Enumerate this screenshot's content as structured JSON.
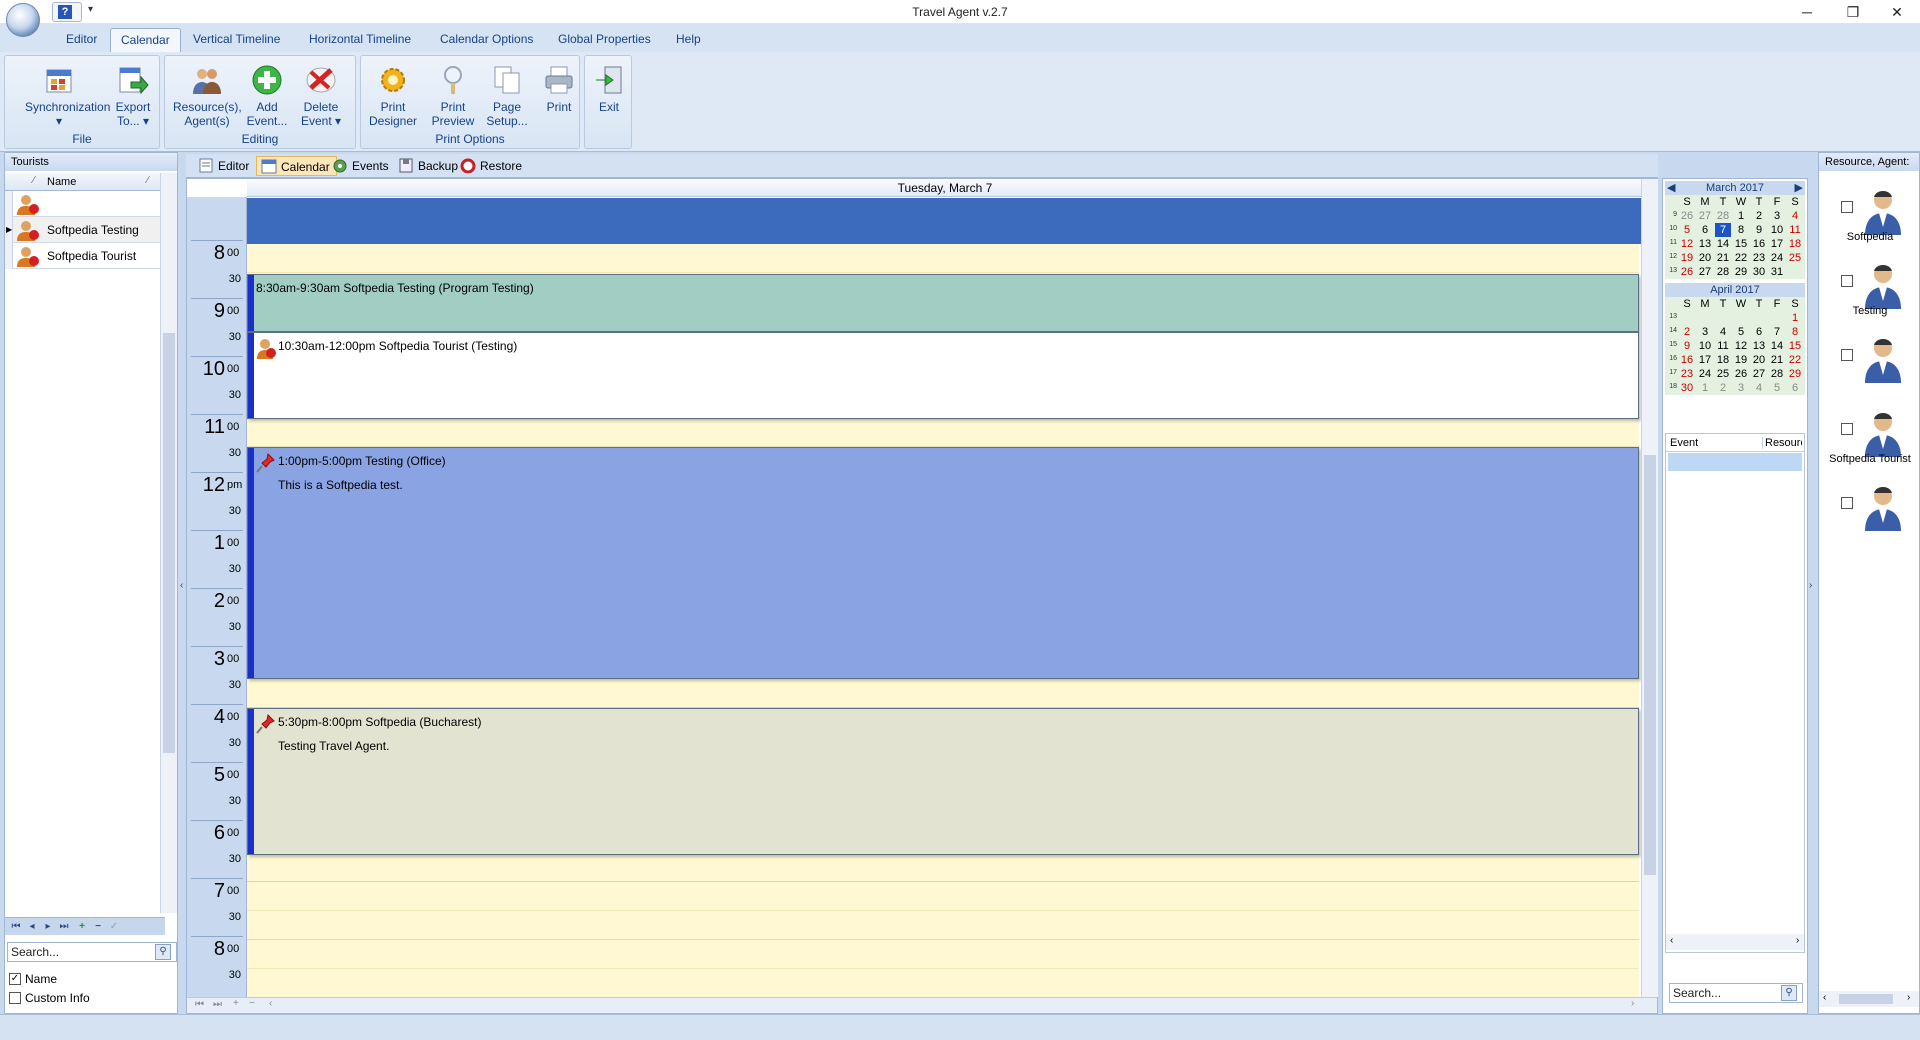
{
  "window": {
    "title": "Travel Agent v.2.7",
    "minimize": "─",
    "maximize": "❐",
    "close": "✕"
  },
  "qat": {
    "help": "?",
    "dropdown": "▾"
  },
  "menu_tabs": [
    {
      "label": "Editor"
    },
    {
      "label": "Calendar",
      "active": true
    },
    {
      "label": "Vertical Timeline"
    },
    {
      "label": "Horizontal Timeline"
    },
    {
      "label": "Calendar Options"
    },
    {
      "label": "Global Properties"
    },
    {
      "label": "Help"
    }
  ],
  "ribbon": {
    "groups": [
      {
        "label": "File",
        "buttons": [
          {
            "line1": "Synchronization",
            "line2": "▾"
          },
          {
            "line1": "Export",
            "line2": "To... ▾"
          }
        ]
      },
      {
        "label": "Editing",
        "buttons": [
          {
            "line1": "Resource(s),",
            "line2": "Agent(s)"
          },
          {
            "line1": "Add",
            "line2": "Event..."
          },
          {
            "line1": "Delete",
            "line2": "Event ▾"
          }
        ]
      },
      {
        "label": "Print Options",
        "buttons": [
          {
            "line1": "Print",
            "line2": "Designer"
          },
          {
            "line1": "Print",
            "line2": "Preview"
          },
          {
            "line1": "Page",
            "line2": "Setup..."
          },
          {
            "line1": "Print",
            "line2": ""
          }
        ]
      },
      {
        "label": "",
        "buttons": [
          {
            "line1": "Exit",
            "line2": ""
          }
        ]
      }
    ]
  },
  "tourists": {
    "title": "Tourists",
    "col_name": "Name",
    "rows": [
      {
        "name": ""
      },
      {
        "name": "Softpedia Testing"
      },
      {
        "name": "Softpedia Tourist"
      }
    ],
    "search_placeholder": "Search...",
    "opt_name": "Name",
    "opt_custom": "Custom Info"
  },
  "sub_tabs": [
    {
      "label": "Editor"
    },
    {
      "label": "Calendar",
      "active": true
    },
    {
      "label": "Events"
    },
    {
      "label": "Backup"
    },
    {
      "label": "Restore"
    }
  ],
  "calendar": {
    "date_header": "Tuesday, March 7",
    "hours": [
      {
        "n": "8",
        "s": "00"
      },
      {
        "n": "9",
        "s": "00"
      },
      {
        "n": "10",
        "s": "00"
      },
      {
        "n": "11",
        "s": "00"
      },
      {
        "n": "12",
        "s": "pm"
      },
      {
        "n": "1",
        "s": "00"
      },
      {
        "n": "2",
        "s": "00"
      },
      {
        "n": "3",
        "s": "00"
      },
      {
        "n": "4",
        "s": "00"
      },
      {
        "n": "5",
        "s": "00"
      },
      {
        "n": "6",
        "s": "00"
      },
      {
        "n": "7",
        "s": "00"
      },
      {
        "n": "8",
        "s": "00"
      }
    ],
    "half": "30",
    "events": [
      {
        "title": "8:30am-9:30am Softpedia Testing (Program Testing)",
        "desc": "",
        "color": "#a1cdc3",
        "icon": "none"
      },
      {
        "title": "10:30am-12:00pm Softpedia Tourist (Testing)",
        "desc": "",
        "color": "#ffffff",
        "icon": "tourist-icon"
      },
      {
        "title": "1:00pm-5:00pm Testing (Office)",
        "desc": "This is a Softpedia test.",
        "color": "#8aa3e2",
        "icon": "pin-icon"
      },
      {
        "title": "5:30pm-8:00pm Softpedia (Bucharest)",
        "desc": "Testing Travel Agent.",
        "color": "#e3e3d2",
        "icon": "pin-icon"
      }
    ]
  },
  "mini_cal": {
    "march": {
      "title": "March 2017",
      "dow": [
        "S",
        "M",
        "T",
        "W",
        "T",
        "F",
        "S"
      ],
      "weeks": [
        "9",
        "10",
        "11",
        "12",
        "13"
      ],
      "days": [
        [
          "26",
          "27",
          "28",
          "1",
          "2",
          "3",
          "4"
        ],
        [
          "5",
          "6",
          "7",
          "8",
          "9",
          "10",
          "11"
        ],
        [
          "12",
          "13",
          "14",
          "15",
          "16",
          "17",
          "18"
        ],
        [
          "19",
          "20",
          "21",
          "22",
          "23",
          "24",
          "25"
        ],
        [
          "26",
          "27",
          "28",
          "29",
          "30",
          "31",
          ""
        ]
      ]
    },
    "april": {
      "title": "April 2017",
      "dow": [
        "S",
        "M",
        "T",
        "W",
        "T",
        "F",
        "S"
      ],
      "weeks": [
        "13",
        "14",
        "15",
        "16",
        "17",
        "18"
      ],
      "days": [
        [
          "",
          "",
          "",
          "",
          "",
          "",
          "1"
        ],
        [
          "2",
          "3",
          "4",
          "5",
          "6",
          "7",
          "8"
        ],
        [
          "9",
          "10",
          "11",
          "12",
          "13",
          "14",
          "15"
        ],
        [
          "16",
          "17",
          "18",
          "19",
          "20",
          "21",
          "22"
        ],
        [
          "23",
          "24",
          "25",
          "26",
          "27",
          "28",
          "29"
        ],
        [
          "30",
          "1",
          "2",
          "3",
          "4",
          "5",
          "6"
        ]
      ]
    },
    "selected": "7",
    "col_event": "Event",
    "col_resource": "Resourc",
    "search_placeholder": "Search..."
  },
  "resources": {
    "title": "Resource, Agent:",
    "items": [
      {
        "name": "Softpedia"
      },
      {
        "name": "Testing"
      },
      {
        "name": ""
      },
      {
        "name": "Softpedia Tourist"
      },
      {
        "name": ""
      }
    ]
  },
  "colors": {
    "accent": "#3c6bbd",
    "event_bar": "#1b2fc9",
    "weekend": "#cc0000"
  }
}
